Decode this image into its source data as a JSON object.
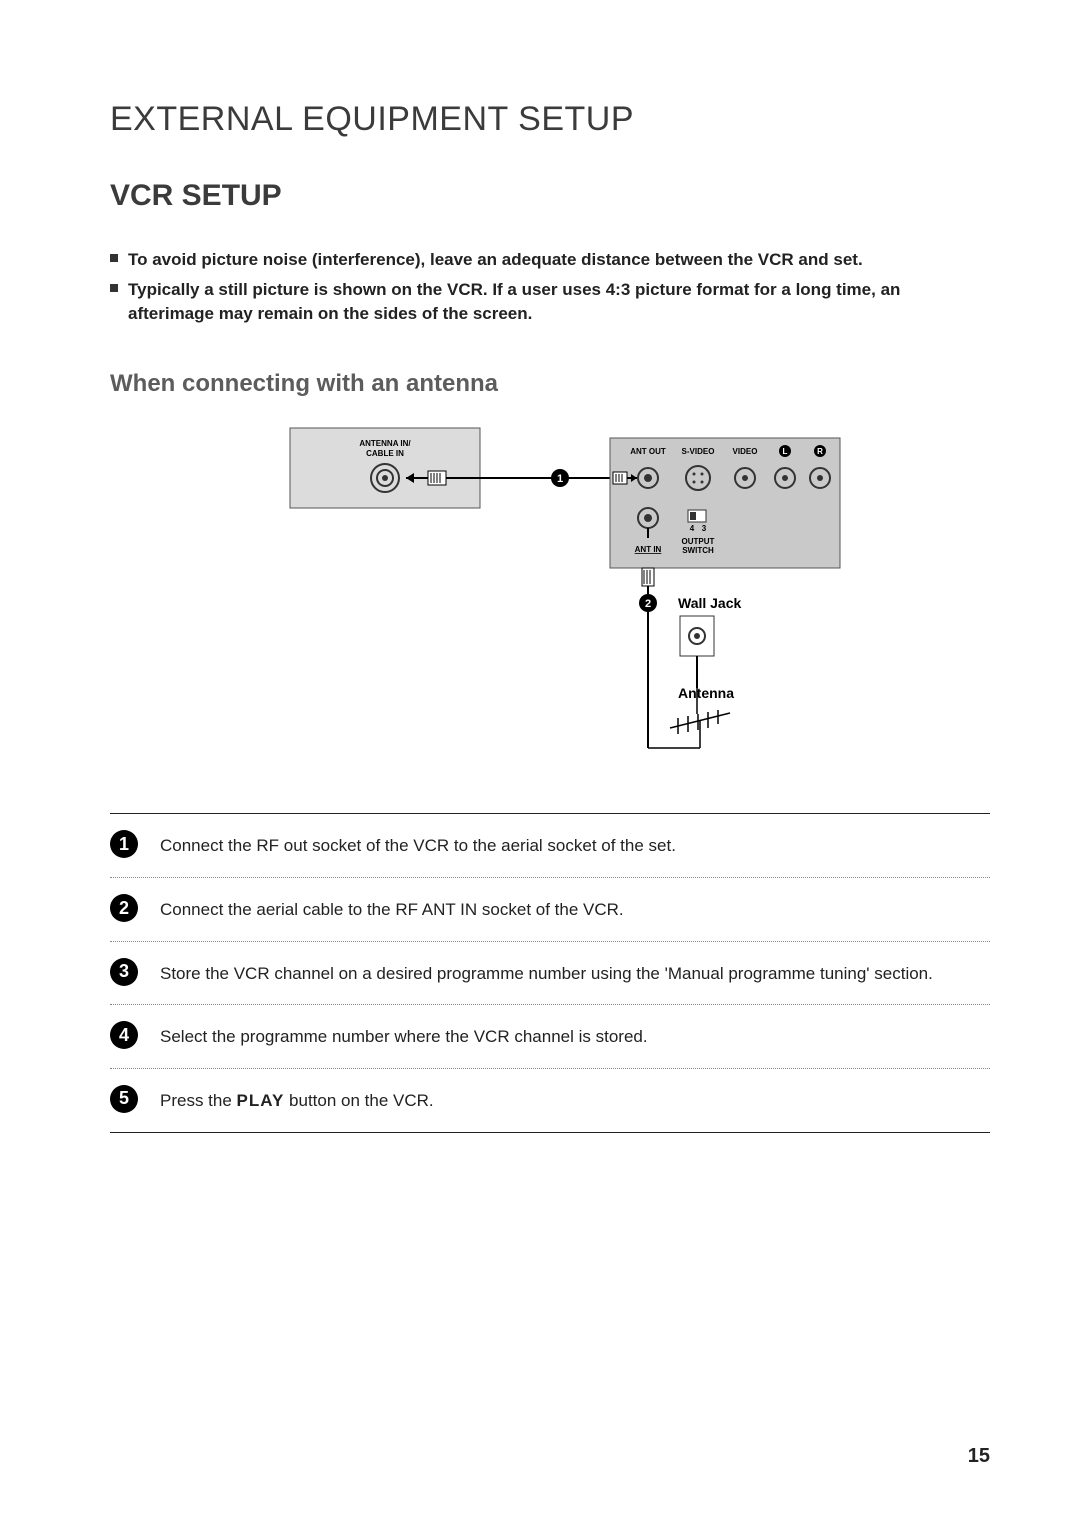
{
  "section_title": "EXTERNAL EQUIPMENT SETUP",
  "sub_title": "VCR SETUP",
  "notes": [
    "To avoid picture noise (interference), leave an adequate distance between the VCR and set.",
    "Typically a still picture is shown on the VCR. If a user uses 4:3 picture format for a long time, an afterimage may remain on the sides of the screen."
  ],
  "conn_title": "When connecting with an antenna",
  "diagram": {
    "tv_label_line1": "ANTENNA IN/",
    "tv_label_line2": "CABLE IN",
    "vcr_labels": {
      "ant_out": "ANT OUT",
      "s_video": "S-VIDEO",
      "video": "VIDEO",
      "l": "L",
      "r": "R",
      "ant_in": "ANT IN",
      "output_switch_l1": "OUTPUT",
      "output_switch_l2": "SWITCH",
      "sw4": "4",
      "sw3": "3"
    },
    "wall_jack": "Wall Jack",
    "antenna": "Antenna",
    "callout1": "1",
    "callout2": "2"
  },
  "steps": [
    {
      "n": "1",
      "text": "Connect the RF out socket of the VCR to the aerial socket of the set."
    },
    {
      "n": "2",
      "text": "Connect the aerial cable to the RF ANT IN socket of the VCR."
    },
    {
      "n": "3",
      "text": "Store the VCR channel on a desired programme number using the 'Manual programme tuning' section."
    },
    {
      "n": "4",
      "text": "Select the programme number where the VCR channel is stored."
    },
    {
      "n": "5",
      "text_pre": "Press the ",
      "text_strong": "PLAY",
      "text_post": " button on the VCR."
    }
  ],
  "page_number": "15"
}
